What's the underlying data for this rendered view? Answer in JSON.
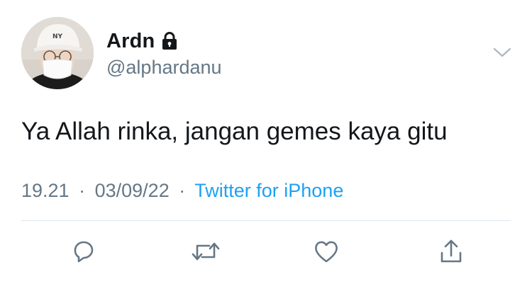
{
  "user": {
    "display_name": "Ardn",
    "handle": "@alphardanu",
    "protected_icon": "lock-icon",
    "avatar_cap_text": "NY"
  },
  "tweet": {
    "text": "Ya Allah rinka, jangan gemes kaya gitu",
    "time": "19.21",
    "separator": "·",
    "date": "03/09/22",
    "source": "Twitter for iPhone"
  },
  "menu": {
    "icon": "chevron-down-icon"
  },
  "actions": [
    {
      "icon": "reply-icon"
    },
    {
      "icon": "retweet-icon"
    },
    {
      "icon": "like-icon"
    },
    {
      "icon": "share-icon"
    }
  ],
  "colors": {
    "text": "#14171a",
    "secondary": "#657786",
    "link": "#1da1f2",
    "divider": "#e1e8ed"
  }
}
